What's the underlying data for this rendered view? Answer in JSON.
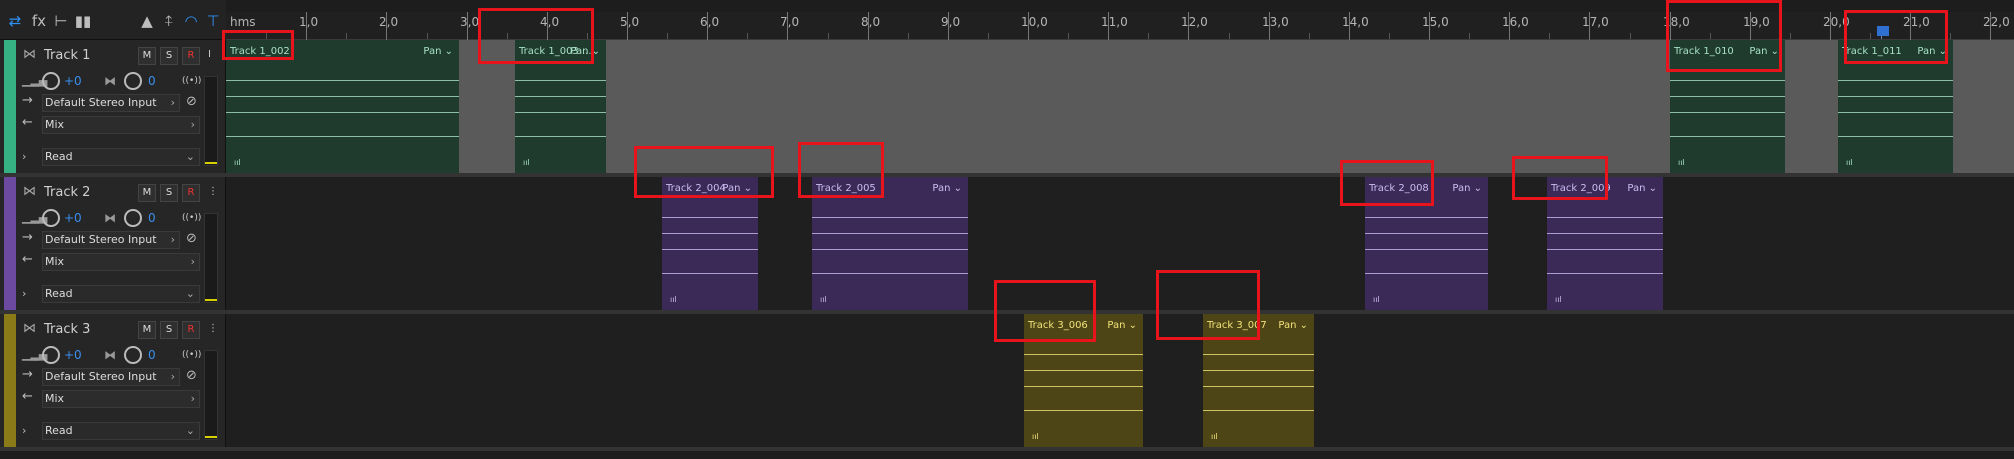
{
  "toolbar": {
    "icons": [
      {
        "name": "loop-toggle-icon",
        "glyph": "⇄",
        "active": true
      },
      {
        "name": "fx-icon",
        "glyph": "fx",
        "active": false
      },
      {
        "name": "routing-icon",
        "glyph": "⊢",
        "active": false
      },
      {
        "name": "level-meter-icon",
        "glyph": "▮▮",
        "active": false
      },
      {
        "name": "metronome-icon",
        "glyph": "▲",
        "active": false
      },
      {
        "name": "time-select-icon",
        "glyph": "⍏",
        "active": false
      },
      {
        "name": "headphone-icon",
        "glyph": "◠",
        "active": true
      },
      {
        "name": "pin-icon",
        "glyph": "⊤",
        "active": true
      }
    ]
  },
  "ruler": {
    "unit_label": "hms",
    "labels": [
      "1,0",
      "2,0",
      "3,0",
      "4,0",
      "5,0",
      "6,0",
      "7,0",
      "8,0",
      "9,0",
      "10,0",
      "11,0",
      "12,0",
      "13,0",
      "14,0",
      "15,0",
      "16,0",
      "17,0",
      "18,0",
      "19,0",
      "20,0",
      "21,0",
      "22,0"
    ]
  },
  "tracks": [
    {
      "name": "Track 1",
      "color": "#36b184",
      "bg": "#5a5a5a",
      "clip_fill": "#1e3b2d",
      "clip_line": "#a8e0c7",
      "buttons": {
        "mute": "M",
        "solo": "S",
        "record": "R",
        "input": "I"
      },
      "volume": "+0",
      "pan": "0",
      "input": "Default Stereo Input",
      "output": "Mix",
      "automation": "Read",
      "clips": [
        {
          "title": "Track 1_002",
          "pan": "Pan",
          "start": 0.0,
          "end": 2.9
        },
        {
          "title": "Track 1_003 ...",
          "pan": "Pan",
          "start": 3.6,
          "end": 4.74
        },
        {
          "title": "Track 1_010",
          "pan": "Pan",
          "start": 18.0,
          "end": 19.44
        },
        {
          "title": "Track 1_011",
          "pan": "Pan",
          "start": 20.1,
          "end": 21.54
        }
      ]
    },
    {
      "name": "Track 2",
      "color": "#6b4aa0",
      "bg": "#1f1f1f",
      "clip_fill": "#3b2a58",
      "clip_line": "#cbbbf0",
      "buttons": {
        "mute": "M",
        "solo": "S",
        "record": "R",
        "input": "⋮"
      },
      "volume": "+0",
      "pan": "0",
      "input": "Default Stereo Input",
      "output": "Mix",
      "automation": "Read",
      "clips": [
        {
          "title": "Track 2_004",
          "pan": "Pan",
          "start": 5.44,
          "end": 6.64
        },
        {
          "title": "Track 2_005",
          "pan": "Pan",
          "start": 7.31,
          "end": 9.26
        },
        {
          "title": "Track 2_008",
          "pan": "Pan",
          "start": 14.2,
          "end": 15.73
        },
        {
          "title": "Track 2_009",
          "pan": "Pan",
          "start": 16.47,
          "end": 17.92
        }
      ]
    },
    {
      "name": "Track 3",
      "color": "#8b7a18",
      "bg": "#1f1f1f",
      "clip_fill": "#4e4516",
      "clip_line": "#f0e27a",
      "buttons": {
        "mute": "M",
        "solo": "S",
        "record": "R",
        "input": "⋮"
      },
      "volume": "+0",
      "pan": "0",
      "input": "Default Stereo Input",
      "output": "Mix",
      "automation": "Read",
      "clips": [
        {
          "title": "Track 3_006",
          "pan": "Pan",
          "start": 9.95,
          "end": 11.44
        },
        {
          "title": "Track 3_007",
          "pan": "Pan",
          "start": 12.18,
          "end": 13.56
        }
      ]
    }
  ],
  "symbols": {
    "chevron_right": "›",
    "chevron_down": "⌄",
    "clip_footer": "ııl",
    "input_arrow": "→",
    "output_arrow": "←",
    "expand": "›",
    "mono": "⊘",
    "stereo": "((•))",
    "grip": "⋈"
  }
}
